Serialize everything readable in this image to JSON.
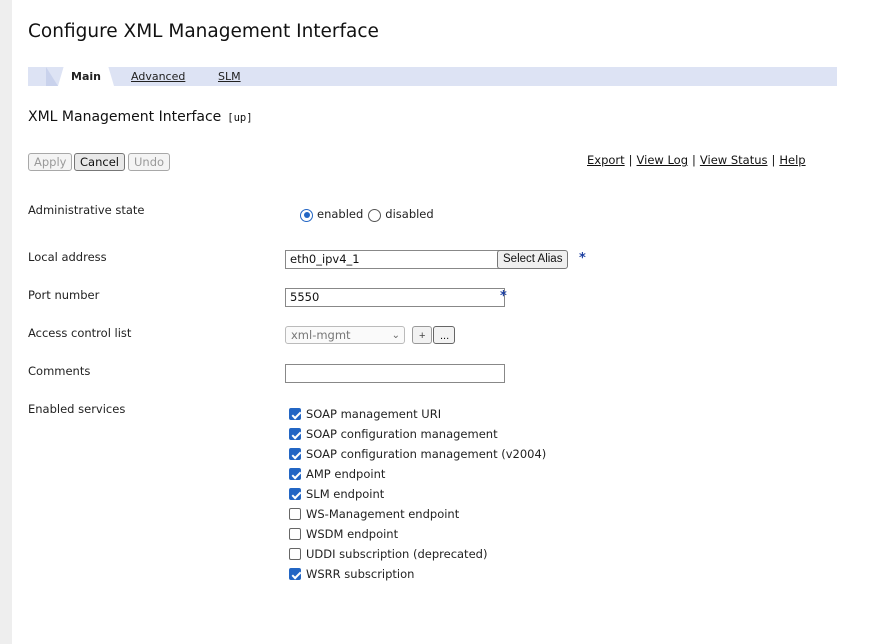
{
  "page": {
    "title": "Configure XML Management Interface"
  },
  "tabs": [
    {
      "label": "Main",
      "active": true
    },
    {
      "label": "Advanced",
      "active": false
    },
    {
      "label": "SLM",
      "active": false
    }
  ],
  "section": {
    "title": "XML Management Interface",
    "status": "[up]"
  },
  "toolbar": {
    "apply": "Apply",
    "cancel": "Cancel",
    "undo": "Undo"
  },
  "links": {
    "export": "Export",
    "view_log": "View Log",
    "view_status": "View Status",
    "help": "Help",
    "separator": "|"
  },
  "form": {
    "admin_state": {
      "label": "Administrative state",
      "options": [
        {
          "label": "enabled",
          "selected": true
        },
        {
          "label": "disabled",
          "selected": false
        }
      ]
    },
    "local_address": {
      "label": "Local address",
      "value": "eth0_ipv4_1",
      "select_alias": "Select Alias",
      "required": "*"
    },
    "port_number": {
      "label": "Port number",
      "value": "5550",
      "required": "*"
    },
    "acl": {
      "label": "Access control list",
      "value": "xml-mgmt",
      "add": "+",
      "more": "..."
    },
    "comments": {
      "label": "Comments",
      "value": ""
    },
    "services": {
      "label": "Enabled services",
      "items": [
        {
          "label": "SOAP management URI",
          "checked": true
        },
        {
          "label": "SOAP configuration management",
          "checked": true
        },
        {
          "label": "SOAP configuration management (v2004)",
          "checked": true
        },
        {
          "label": "AMP endpoint",
          "checked": true
        },
        {
          "label": "SLM endpoint",
          "checked": true
        },
        {
          "label": "WS-Management endpoint",
          "checked": false
        },
        {
          "label": "WSDM endpoint",
          "checked": false
        },
        {
          "label": "UDDI subscription (deprecated)",
          "checked": false
        },
        {
          "label": "WSRR subscription",
          "checked": true
        }
      ]
    }
  },
  "colors": {
    "tabbar": "#dde3f4",
    "accent": "#2366c4",
    "required": "#1c3fa0"
  }
}
